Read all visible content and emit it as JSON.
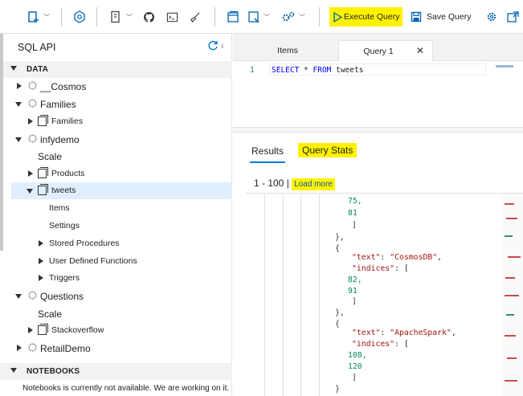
{
  "toolbar": {
    "execute_label": "Execute Query",
    "save_label": "Save Query"
  },
  "sidebar": {
    "title": "SQL API",
    "data_section": "DATA",
    "notebooks_section": "NOTEBOOKS",
    "notebooks_message": "Notebooks is currently not available. We are working on it.",
    "tree": {
      "cosmos": "__Cosmos",
      "families_db": "Families",
      "families_coll": "Families",
      "infydemo": "infydemo",
      "infydemo_scale": "Scale",
      "products": "Products",
      "tweets": "tweets",
      "items": "Items",
      "settings": "Settings",
      "stored_procedures": "Stored Procedures",
      "udfs": "User Defined Functions",
      "triggers": "Triggers",
      "questions": "Questions",
      "questions_scale": "Scale",
      "stackoverflow": "Stackoverflow",
      "retaildemo": "RetailDemo"
    }
  },
  "tabs": {
    "items": "Items",
    "query": "Query 1"
  },
  "editor": {
    "line_number": "1",
    "kw_select": "SELECT",
    "star": " * ",
    "kw_from": "FROM",
    "table": " tweets"
  },
  "results": {
    "results_tab": "Results",
    "stats_tab": "Query Stats",
    "range": "1 - 100 |",
    "load_more": "Load more"
  },
  "json": {
    "n75": "75,",
    "n81": "81",
    "close_bracket": "]",
    "close_brace_comma": "},",
    "open_brace": "{",
    "text_key": "\"text\"",
    "text_val_1": "\"CosmosDB\"",
    "indices_key": "\"indices\"",
    "n82": "82,",
    "n91": "91",
    "text_val_2": "\"ApacheSpark\"",
    "n108": "108,",
    "n120": "120",
    "close_brace": "}"
  },
  "colors": {
    "accent": "#0078d4",
    "highlight": "#fff200",
    "selected_row": "#e0eeff"
  }
}
